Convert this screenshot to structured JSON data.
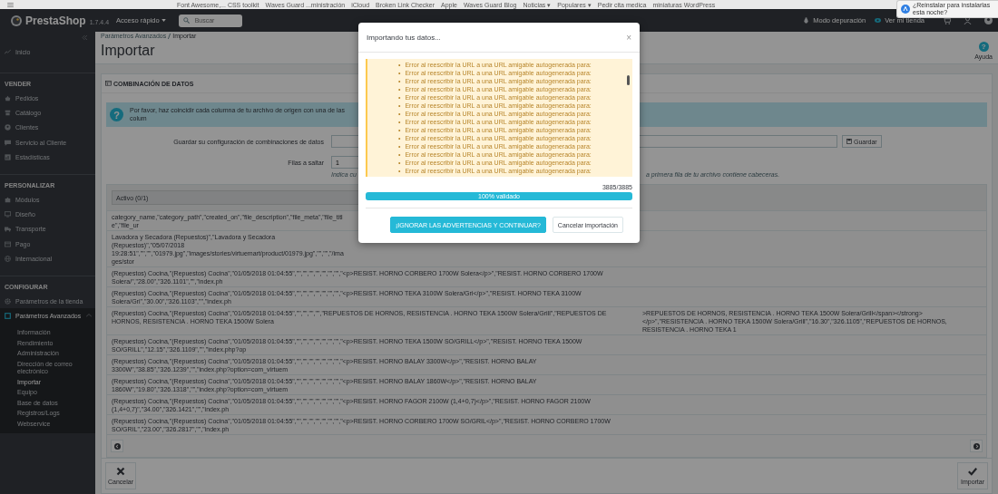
{
  "bookmarks_bar": {
    "items": [
      "Font Awesome,... CSS toolkit",
      "Waves Guard ...ministración",
      "iCloud",
      "Broken Link Checker",
      "Apple",
      "Waves Guard Blog",
      "Noticias ▾",
      "Populares ▾",
      "Pedir cita medica",
      "miniaturas WordPress"
    ]
  },
  "notification": {
    "text": "¿Reinstalar para instalarlas esta noche?"
  },
  "topbar": {
    "logo": "PrestaShop",
    "version": "1.7.4.4",
    "quick_access": "Acceso rápido",
    "search": {
      "placeholder": "Buscar"
    },
    "debug_mode": "Modo depuración",
    "view_store": "Ver mi tienda"
  },
  "sidebar": {
    "sections": [
      {
        "items": [
          {
            "label": "Inicio",
            "selected": false
          }
        ]
      },
      {
        "title": "VENDER",
        "items": [
          {
            "label": "Pedidos",
            "selected": false
          },
          {
            "label": "Catálogo",
            "selected": false
          },
          {
            "label": "Clientes",
            "selected": false
          },
          {
            "label": "Servicio al Cliente",
            "selected": false
          },
          {
            "label": "Estadísticas",
            "selected": false
          }
        ]
      },
      {
        "title": "PERSONALIZAR",
        "items": [
          {
            "label": "Módulos",
            "selected": false
          },
          {
            "label": "Diseño",
            "selected": false
          },
          {
            "label": "Transporte",
            "selected": false
          },
          {
            "label": "Pago",
            "selected": false
          },
          {
            "label": "Internacional",
            "selected": false
          }
        ]
      },
      {
        "title": "CONFIGURAR",
        "items": [
          {
            "label": "Parámetros de la tienda",
            "selected": false
          },
          {
            "label": "Parámetros Avanzados",
            "selected": true,
            "expanded": true,
            "children": [
              {
                "label": "Información",
                "selected": false
              },
              {
                "label": "Rendimiento",
                "selected": false
              },
              {
                "label": "Administración",
                "selected": false
              },
              {
                "label": "Dirección de correo electrónico",
                "selected": false
              },
              {
                "label": "Importar",
                "selected": true
              },
              {
                "label": "Equipo",
                "selected": false
              },
              {
                "label": "Base de datos",
                "selected": false
              },
              {
                "label": "Registros/Logs",
                "selected": false
              },
              {
                "label": "Webservice",
                "selected": false
              }
            ]
          }
        ]
      }
    ]
  },
  "header": {
    "breadcrumb": [
      "Parámetros Avanzados",
      "Importar"
    ],
    "title": "Importar",
    "help": {
      "glyph": "?",
      "label": "Ayuda"
    }
  },
  "panel": {
    "title": "COMBINACIÓN DE DATOS",
    "alert": {
      "glyph": "?",
      "text": "Por favor, haz coincidir cada columna de tu archivo de origen con una de las colum"
    },
    "save_config": {
      "label": "Guardar su configuración de combinaciones de datos",
      "button": "Guardar"
    },
    "skip_rows": {
      "label": "Filas a saltar",
      "value": "1",
      "hint_left": "Indica cu",
      "hint_right": "a primera fila de tu archivo contiene cabeceras."
    },
    "table": {
      "column_select": "Activo (0/1)",
      "rows": [
        {
          "column_1": "category_name,\"category_path\",\"created_on\",\"file_description\",\"file_meta\",\"file_title\",\"file_ur"
        },
        {
          "column_1": "Lavadora y Secadora (Repuestos)\",\"Lavadora y Secadora (Repuestos)\",\"05/07/2018 19:28:51\",\"\",\"\",\"01979.jpg\",\"images/stories/virtuemart/product/01979.jpg\",\"\",\"\",\"/images/stor"
        },
        {
          "column_1": "(Repuestos) Cocina,\"(Repuestos) Cocina\",\"01/05/2018 01:04:55\",\"\",\"\",\"\",\"\",\"\",\"\",\"\",\"<p>RESIST. HORNO CORBERO 1700W Solera</p>\",\"RESIST. HORNO CORBERO 1700W Solera/\",\"28.00\",\"326.1101\",\"\",\"index.ph"
        },
        {
          "column_1": "(Repuestos) Cocina,\"(Repuestos) Cocina\",\"01/05/2018 01:04:55\",\"\",\"\",\"\",\"\",\"\",\"\",\"\",\"<p>RESIST. HORNO TEKA 3100W Solera/Gri</p>\",\"RESIST. HORNO TEKA 3100W Solera/Gri\",\"30.00\",\"326.1103\",\"\",\"index.ph"
        },
        {
          "column_1": "(Repuestos) Cocina,\"(Repuestos) Cocina\",\"01/05/2018 01:04:55\",\"\",\"\",\"\",\"\",\"REPUESTOS DE HORNOS, RESISTENCIA . HORNO TEKA 1500W Solera/Grill\",\"REPUESTOS DE HORNOS, RESISTENCIA . HORNO TEKA 1500W Solera",
          "column_2": ">REPUESTOS DE HORNOS, RESISTENCIA . HORNO TEKA 1500W Solera/Grill</span></strong></p>\",\"RESISTENCIA . HORNO TEKA 1500W Solera/Grill\",\"16.30\",\"326.1105\",\"REPUESTOS DE HORNOS, RESISTENCIA . HORNO TEKA 1"
        },
        {
          "column_1": "(Repuestos) Cocina,\"(Repuestos) Cocina\",\"01/05/2018 01:04:55\",\"\",\"\",\"\",\"\",\"\",\"\",\"\",\"<p>RESIST. HORNO TEKA 1500W SO/GRILL</p>\",\"RESIST. HORNO TEKA 1500W SO/GRILL\",\"12.15\",\"326.1109\",\"\",\"index.php?op"
        },
        {
          "column_1": "(Repuestos) Cocina,\"(Repuestos) Cocina\",\"01/05/2018 01:04:55\",\"\",\"\",\"\",\"\",\"\",\"\",\"\",\"<p>RESIST. HORNO BALAY 3300W</p>\",\"RESIST. HORNO BALAY 3300W\",\"38.85\",\"326.1239\",\"\",\"index.php?option=com_virtuem"
        },
        {
          "column_1": "(Repuestos) Cocina,\"(Repuestos) Cocina\",\"01/05/2018 01:04:55\",\"\",\"\",\"\",\"\",\"\",\"\",\"\",\"<p>RESIST. HORNO BALAY 1860W</p>\",\"RESIST. HORNO BALAY 1860W\",\"19.80\",\"326.1318\",\"\",\"index.php?option=com_virtuem"
        },
        {
          "column_1": "(Repuestos) Cocina,\"(Repuestos) Cocina\",\"01/05/2018 01:04:55\",\"\",\"\",\"\",\"\",\"\",\"\",\"\",\"<p>RESIST. HORNO FAGOR 2100W (1,4+0,7)</p>\",\"RESIST. HORNO FAGOR 2100W (1,4+0,7)\",\"34.00\",\"326.1421\",\"\",\"index.ph"
        },
        {
          "column_1": "(Repuestos) Cocina,\"(Repuestos) Cocina\",\"01/05/2018 01:04:55\",\"\",\"\",\"\",\"\",\"\",\"\",\"\",\"<p>RESIST. HORNO CORBERO 1700W SO/GRIL</p>\",\"RESIST. HORNO CORBERO 1700W SO/GRIL\",\"23.00\",\"326.2817\",\"\",\"index.ph"
        }
      ]
    },
    "footer": {
      "cancel": "Cancelar",
      "import": "Importar"
    }
  },
  "modal": {
    "title": "Importando tus datos...",
    "close": "×",
    "bullet": "•",
    "warnings": [
      "Error al reescribir la URL a una URL amigable autogenerada para:",
      "Error al reescribir la URL a una URL amigable autogenerada para:",
      "Error al reescribir la URL a una URL amigable autogenerada para:",
      "Error al reescribir la URL a una URL amigable autogenerada para:",
      "Error al reescribir la URL a una URL amigable autogenerada para:",
      "Error al reescribir la URL a una URL amigable autogenerada para:",
      "Error al reescribir la URL a una URL amigable autogenerada para:",
      "Error al reescribir la URL a una URL amigable autogenerada para:",
      "Error al reescribir la URL a una URL amigable autogenerada para:",
      "Error al reescribir la URL a una URL amigable autogenerada para:",
      "Error al reescribir la URL a una URL amigable autogenerada para:",
      "Error al reescribir la URL a una URL amigable autogenerada para:",
      "Error al reescribir la URL a una URL amigable autogenerada para:",
      "Error al reescribir la URL a una URL amigable autogenerada para:"
    ],
    "count": "3885/3885",
    "progress": {
      "level": 1,
      "label": "100% validado"
    },
    "buttons": {
      "primary": "¡IGNORAR LAS ADVERTENCIAS Y CONTINUAR?",
      "secondary": "Cancelar importación"
    }
  }
}
